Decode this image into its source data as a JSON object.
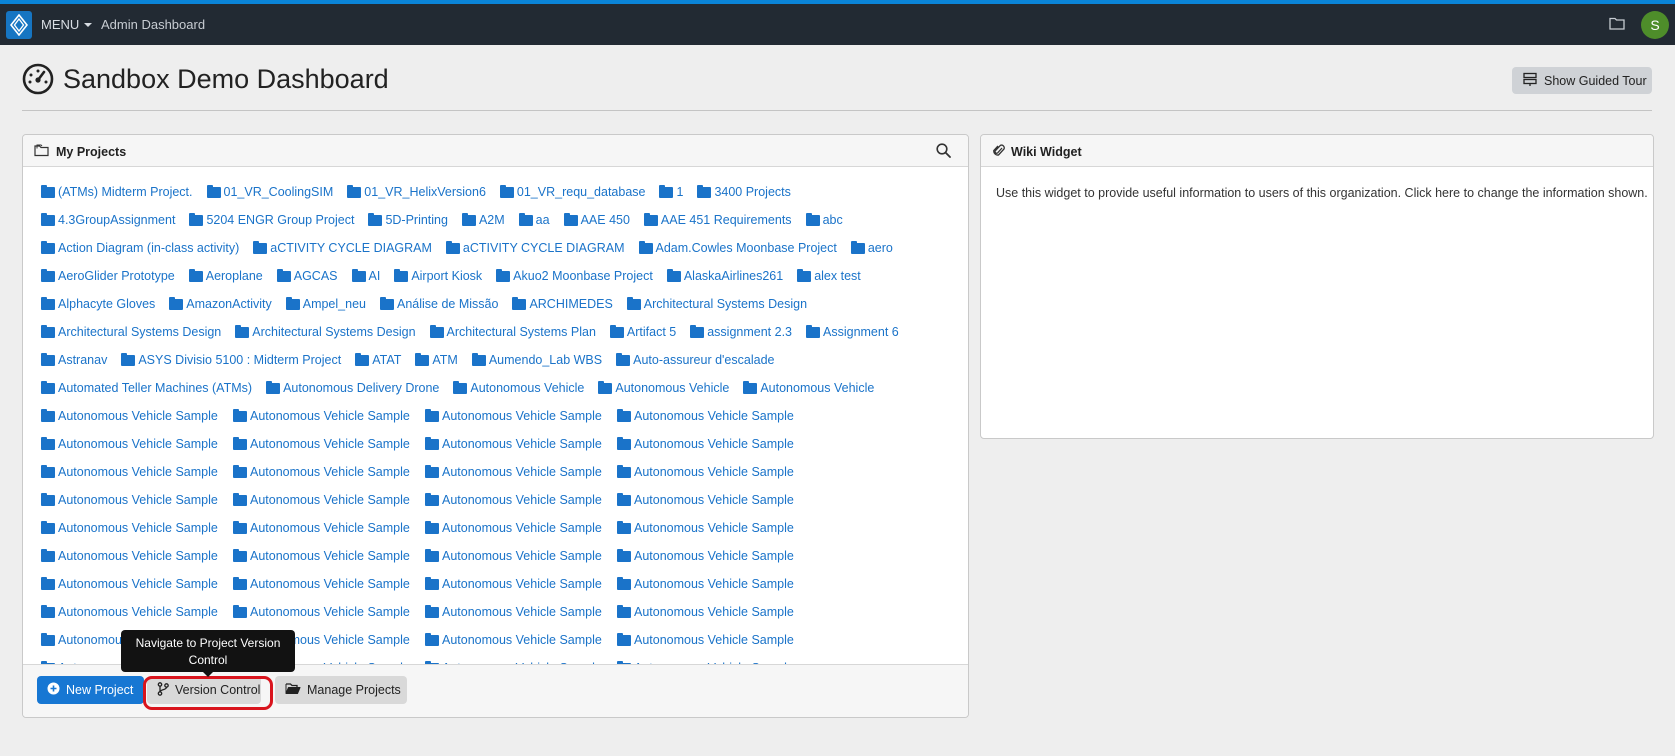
{
  "navbar": {
    "menu_label": "MENU",
    "admin_label": "Admin Dashboard",
    "avatar_initial": "S",
    "logo_icon": "diamond-logo-icon",
    "folder_icon": "folder-icon"
  },
  "page": {
    "title": "Sandbox Demo Dashboard",
    "title_icon": "dashboard-gauge-icon",
    "tour_button": "Show Guided Tour"
  },
  "projects_panel": {
    "title": "My Projects",
    "rows": [
      [
        "(ATMs) Midterm Project.",
        "01_VR_CoolingSIM",
        "01_VR_HelixVersion6",
        "01_VR_requ_database",
        "1",
        "3400 Projects"
      ],
      [
        "4.3GroupAssignment",
        "5204 ENGR Group Project",
        "5D-Printing",
        "A2M",
        "aa",
        "AAE 450",
        "AAE 451 Requirements",
        "abc"
      ],
      [
        "Action Diagram (in-class activity)",
        "aCTIVITY CYCLE DIAGRAM",
        "aCTIVITY CYCLE DIAGRAM",
        "Adam.Cowles Moonbase Project",
        "aero"
      ],
      [
        "AeroGlider Prototype",
        "Aeroplane",
        "AGCAS",
        "AI",
        "Airport Kiosk",
        "Akuo2 Moonbase Project",
        "AlaskaAirlines261",
        "alex test"
      ],
      [
        "Alphacyte Gloves",
        "AmazonActivity",
        "Ampel_neu",
        "Análise de Missão",
        "ARCHIMEDES",
        "Architectural Systems Design"
      ],
      [
        "Architectural Systems Design",
        "Architectural Systems Design",
        "Architectural Systems Plan",
        "Artifact 5",
        "assignment 2.3",
        "Assignment 6"
      ],
      [
        "Astranav",
        "ASYS Divisio 5100 : Midterm Project",
        "ATAT",
        "ATM",
        "Aumendo_Lab WBS",
        "Auto-assureur d'escalade"
      ],
      [
        "Automated Teller Machines (ATMs)",
        "Autonomous Delivery Drone",
        "Autonomous Vehicle",
        "Autonomous Vehicle",
        "Autonomous Vehicle"
      ],
      [
        "Autonomous Vehicle Sample",
        "Autonomous Vehicle Sample",
        "Autonomous Vehicle Sample",
        "Autonomous Vehicle Sample"
      ],
      [
        "Autonomous Vehicle Sample",
        "Autonomous Vehicle Sample",
        "Autonomous Vehicle Sample",
        "Autonomous Vehicle Sample"
      ],
      [
        "Autonomous Vehicle Sample",
        "Autonomous Vehicle Sample",
        "Autonomous Vehicle Sample",
        "Autonomous Vehicle Sample"
      ],
      [
        "Autonomous Vehicle Sample",
        "Autonomous Vehicle Sample",
        "Autonomous Vehicle Sample",
        "Autonomous Vehicle Sample"
      ],
      [
        "Autonomous Vehicle Sample",
        "Autonomous Vehicle Sample",
        "Autonomous Vehicle Sample",
        "Autonomous Vehicle Sample"
      ],
      [
        "Autonomous Vehicle Sample",
        "Autonomous Vehicle Sample",
        "Autonomous Vehicle Sample",
        "Autonomous Vehicle Sample"
      ],
      [
        "Autonomous Vehicle Sample",
        "Autonomous Vehicle Sample",
        "Autonomous Vehicle Sample",
        "Autonomous Vehicle Sample"
      ],
      [
        "Autonomous Vehicle Sample",
        "Autonomous Vehicle Sample",
        "Autonomous Vehicle Sample",
        "Autonomous Vehicle Sample"
      ],
      [
        "Autonomous Vehicle Sample",
        "Autonomous Vehicle Sample",
        "Autonomous Vehicle Sample",
        "Autonomous Vehicle Sample"
      ],
      [
        "Autonomous Vehicle Sample",
        "Autonomous Vehicle Sample",
        "Autonomous Vehicle Sample",
        "Autonomous Vehicle Sample"
      ]
    ],
    "buttons": {
      "new_project": "New Project",
      "version_control": "Version Control",
      "manage_projects": "Manage Projects"
    },
    "tooltip": "Navigate to Project Version Control"
  },
  "wiki_panel": {
    "title": "Wiki Widget",
    "text": "Use this widget to provide useful information to users of this organization. Click here to change the information shown."
  },
  "colors": {
    "accent_stripe": "#0a84d8",
    "navbar_bg": "#222a33",
    "link": "#1a73c9",
    "primary_button": "#1777d3",
    "highlight": "#d9141d",
    "avatar": "#4e8d2a"
  }
}
